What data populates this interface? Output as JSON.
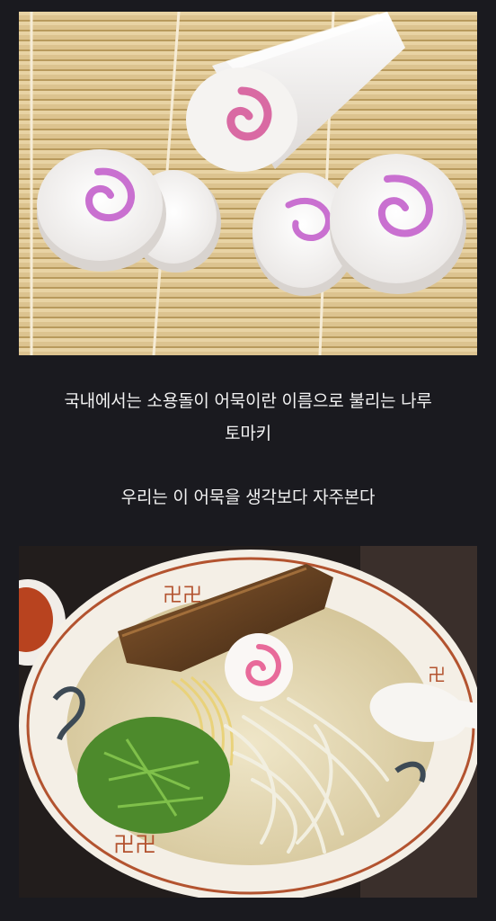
{
  "caption": {
    "line1": "국내에서는 소용돌이 어묵이란 이름으로 불리는 나루",
    "line2": "토마키",
    "line3": "우리는 이 어묵을 생각보다 자주본다"
  },
  "images": {
    "top": "narutomaki-on-bamboo-mat-photo",
    "bottom": "ramen-bowl-with-narutomaki-photo"
  },
  "colors": {
    "background": "#1a1a1f",
    "text": "#f2f2f2",
    "bamboo": "#d9c08a",
    "swirl_pink": "#d96aa3",
    "broth": "#e6dcb8"
  }
}
